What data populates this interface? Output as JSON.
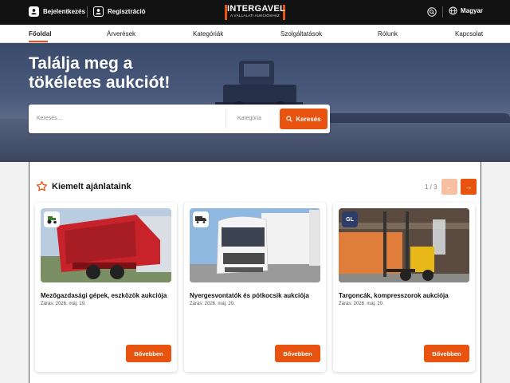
{
  "topbar": {
    "login_label": "Bejelentkezés",
    "register_label": "Regisztráció",
    "logo_name": "INTERGAVEL",
    "logo_tagline": "A VÁLLALATI AUKCIÓSHÁZ",
    "language_label": "Magyar"
  },
  "nav": {
    "items": [
      "Főoldal",
      "Árverések",
      "Kategóriák",
      "Szolgáltatások",
      "Rólunk",
      "Kapcsolat"
    ]
  },
  "hero": {
    "title_line1": "Találja meg a",
    "title_line2": "tökéletes aukciót!",
    "search_placeholder": "Keresés...",
    "category_placeholder": "Kategória",
    "search_button": "Keresés"
  },
  "featured": {
    "title": "Kiemelt ajánlataink",
    "pager": "1 / 3",
    "cards": [
      {
        "badge": "tractor-icon",
        "title": "Mezőgazdasági gépek, eszközök aukciója",
        "date": "Zárás: 2026. máj. 19.",
        "button": "Bővebben"
      },
      {
        "badge": "truck-icon",
        "title": "Nyergesvontatók és pótkocsik aukciója",
        "date": "Zárás: 2026. máj. 20.",
        "button": "Bővebben"
      },
      {
        "badge": "GL",
        "title": "Targoncák, kompresszorok aukciója",
        "date": "Zárás: 2026. máj. 20.",
        "button": "Bővebben"
      }
    ]
  },
  "colors": {
    "accent": "#e8540f",
    "topbar": "#111111"
  }
}
